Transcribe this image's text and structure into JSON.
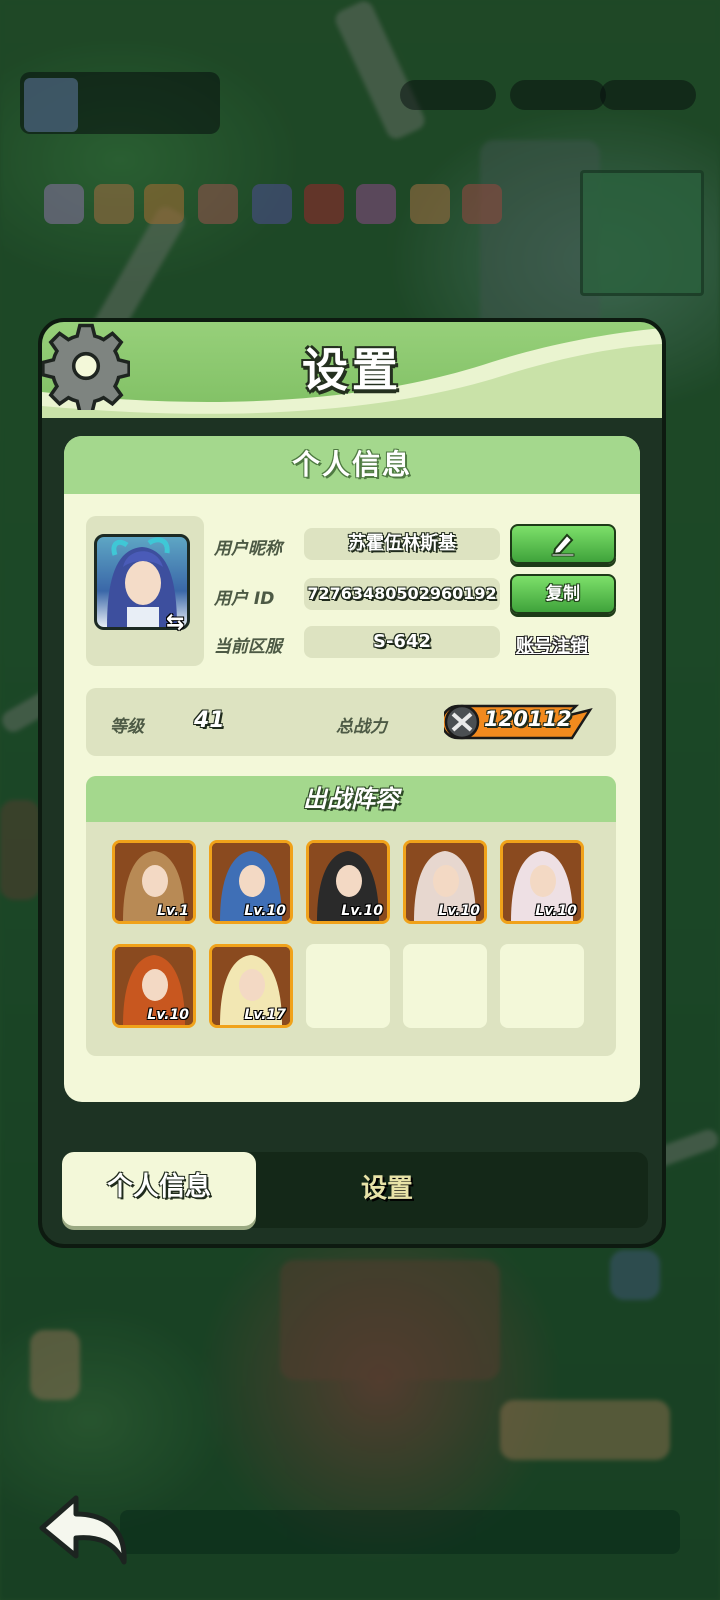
{
  "dialog": {
    "title": "设置",
    "gear_icon": "gear-icon"
  },
  "profile_card": {
    "header": "个人信息",
    "nickname_label": "用户昵称",
    "nickname_value": "苏霍伍林斯基",
    "id_label": "用户 ID",
    "id_value": "72763480502960192",
    "server_label": "当前区服",
    "server_value": "S-642",
    "edit_icon": "pencil-icon",
    "copy_label": "复制",
    "logout_label": "账号注销",
    "level_label": "等级",
    "level_value": "41",
    "power_label": "总战力",
    "power_value": "120112"
  },
  "lineup": {
    "header": "出战阵容",
    "slots": [
      {
        "level": "Lv.1",
        "tint": "#b88a55"
      },
      {
        "level": "Lv.10",
        "tint": "#3f6fb6"
      },
      {
        "level": "Lv.10",
        "tint": "#2a2a2a"
      },
      {
        "level": "Lv.10",
        "tint": "#e7d7cf"
      },
      {
        "level": "Lv.10",
        "tint": "#eee0e4"
      },
      {
        "level": "Lv.10",
        "tint": "#c8571f"
      },
      {
        "level": "Lv.17",
        "tint": "#f2e7b3"
      }
    ],
    "empty_slots": 3
  },
  "tabs": {
    "info": "个人信息",
    "settings": "设置"
  },
  "colors": {
    "header_green": "#8fca72",
    "card_bg": "#f3f8d9",
    "button_green": "#4fb546",
    "slot_border": "#f0a21a"
  }
}
